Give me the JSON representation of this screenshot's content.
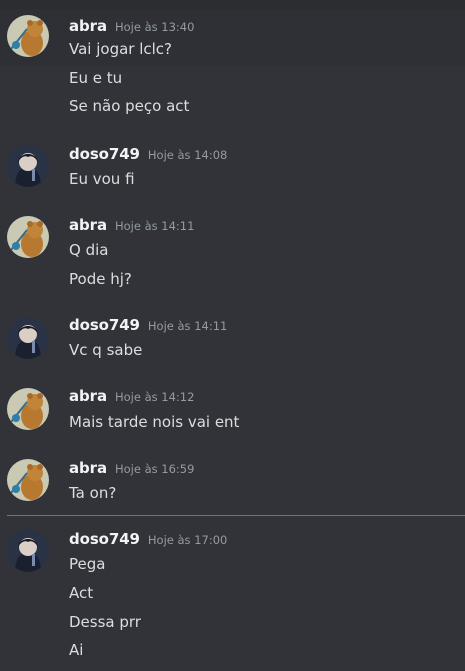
{
  "users": {
    "abra": "abra",
    "doso": "doso749"
  },
  "messages": [
    {
      "user": "abra",
      "time": "Hoje às 13:40",
      "lines": [
        "Vai jogar lclc?",
        "Eu e tu",
        "Se não peço act"
      ]
    },
    {
      "user": "doso749",
      "time": "Hoje às 14:08",
      "lines": [
        "Eu vou fi"
      ]
    },
    {
      "user": "abra",
      "time": "Hoje às 14:11",
      "lines": [
        "Q dia",
        "Pode hj?"
      ]
    },
    {
      "user": "doso749",
      "time": "Hoje às 14:11",
      "lines": [
        "Vc q sabe"
      ]
    },
    {
      "user": "abra",
      "time": "Hoje às 14:12",
      "lines": [
        "Mais tarde nois vai ent"
      ]
    },
    {
      "user": "abra",
      "time": "Hoje às 16:59",
      "lines": [
        "Ta on?"
      ]
    },
    {
      "user": "doso749",
      "time": "Hoje às 17:00",
      "lines": [
        "Pega",
        "Act",
        "Dessa prr",
        "Ai"
      ]
    }
  ],
  "colors": {
    "background": "#313338",
    "new_messages_divider": "#f23f43",
    "username": "#f2f3f5",
    "timestamp": "#949ba4",
    "text": "#dbdee1"
  },
  "icons": {
    "abra_avatar": "bear-with-bindle-avatar",
    "doso_avatar": "dark-anime-character-avatar"
  }
}
